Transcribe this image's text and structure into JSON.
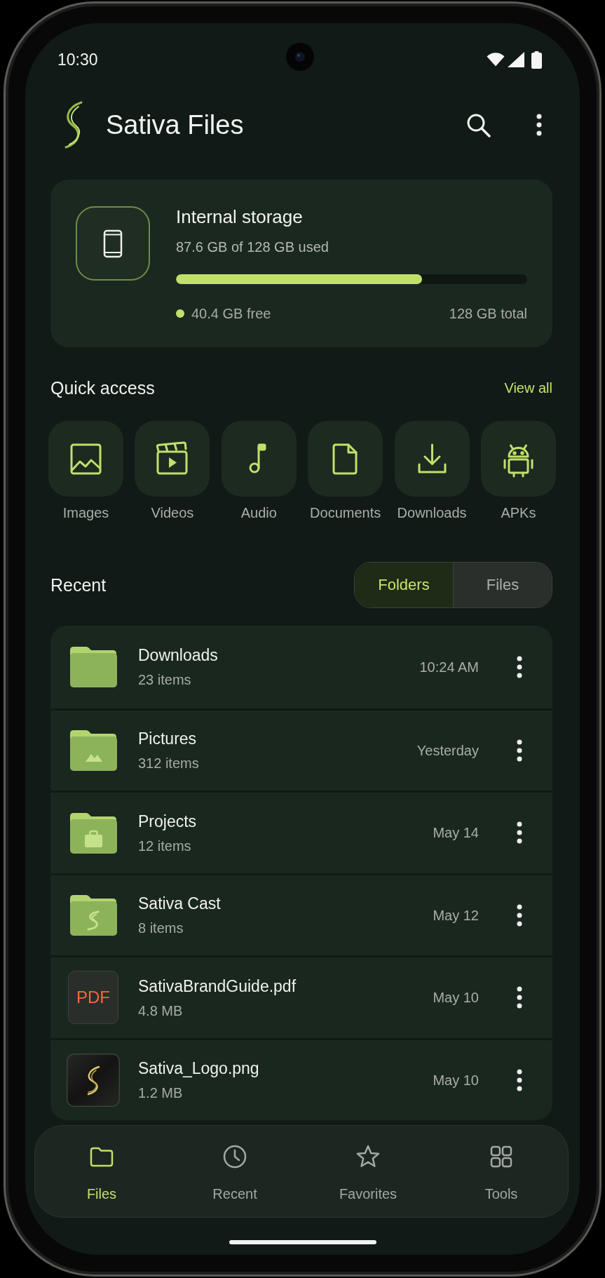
{
  "status_bar": {
    "time": "10:30"
  },
  "app_bar": {
    "title": "Sativa Files"
  },
  "storage": {
    "title": "Internal storage",
    "usage": "87.6 GB of 128 GB used",
    "level": 0.7,
    "free": "40.4 GB free",
    "total": "128 GB total"
  },
  "quick_access": {
    "title": "Quick access",
    "action": "View all",
    "items": [
      {
        "kind": "images",
        "label": "Images"
      },
      {
        "kind": "videos",
        "label": "Videos"
      },
      {
        "kind": "audio",
        "label": "Audio"
      },
      {
        "kind": "documents",
        "label": "Documents"
      },
      {
        "kind": "downloads",
        "label": "Downloads"
      },
      {
        "kind": "apps",
        "label": "APKs"
      }
    ]
  },
  "recent": {
    "title": "Recent",
    "toggle": [
      {
        "label": "Folders",
        "selected": true
      },
      {
        "label": "Files",
        "selected": false
      }
    ],
    "rows": [
      {
        "kind": "folder",
        "name": "Downloads",
        "detail": "23 items",
        "date": "10:24 AM"
      },
      {
        "kind": "photos",
        "name": "Pictures",
        "detail": "312 items",
        "date": "Yesterday"
      },
      {
        "kind": "work",
        "name": "Projects",
        "detail": "12 items",
        "date": "May 14"
      },
      {
        "kind": "brand",
        "name": "Sativa Cast",
        "detail": "8 items",
        "date": "May 12"
      },
      {
        "kind": "pdf",
        "badge": "PDF",
        "name": "SativaBrandGuide.pdf",
        "detail": "4.8 MB",
        "date": "May 10"
      },
      {
        "kind": "image",
        "name": "Sativa_Logo.png",
        "detail": "1.2 MB",
        "date": "May 10"
      }
    ]
  },
  "bottom_nav": [
    {
      "kind": "files",
      "label": "Files",
      "selected": true
    },
    {
      "kind": "recent",
      "label": "Recent",
      "selected": false
    },
    {
      "kind": "favorites",
      "label": "Favorites",
      "selected": false
    },
    {
      "kind": "tools",
      "label": "Tools",
      "selected": false
    }
  ]
}
